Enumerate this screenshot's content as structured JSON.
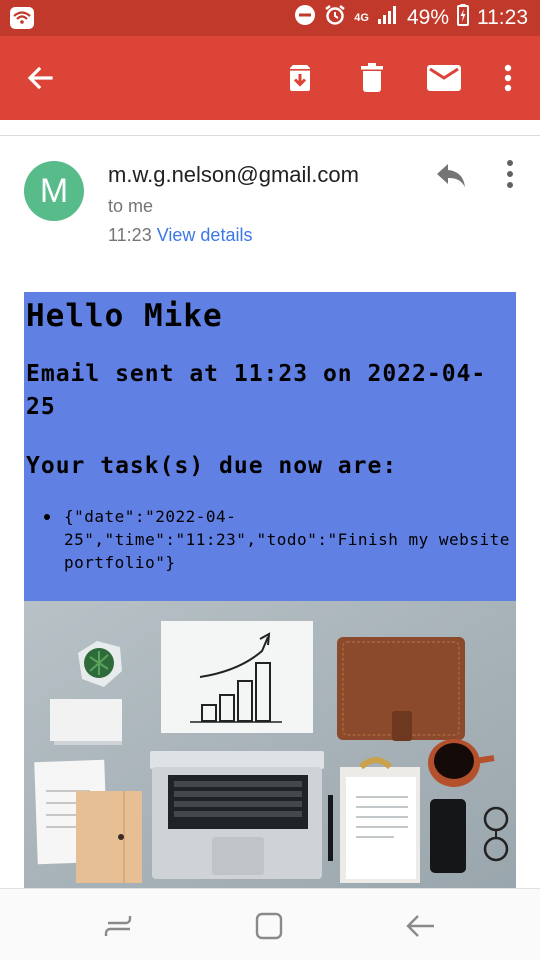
{
  "status_bar": {
    "network": "4G",
    "battery": "49%",
    "time": "11:23"
  },
  "toolbar": {
    "back_icon": "arrow-back-icon",
    "archive_icon": "archive-icon",
    "delete_icon": "trash-icon",
    "mark_unread_icon": "mail-icon",
    "more_icon": "more-vert-icon"
  },
  "message": {
    "avatar_letter": "M",
    "avatar_color": "#57bb8a",
    "sender": "m.w.g.nelson@gmail.com",
    "recipient": "to me",
    "time": "11:23",
    "details_link": "View details"
  },
  "email": {
    "greeting": "Hello Mike",
    "sent_line": "Email sent at 11:23 on 2022-04-25",
    "tasks_heading": "Your task(s) due now are:",
    "tasks": [
      "{\"date\":\"2022-04-25\",\"time\":\"11:23\",\"todo\":\"Finish my website portfolio\"}"
    ],
    "background_color": "#6180e4"
  },
  "colors": {
    "status_bar": "#c0392b",
    "app_bar": "#db4437",
    "link": "#3b78e7"
  }
}
